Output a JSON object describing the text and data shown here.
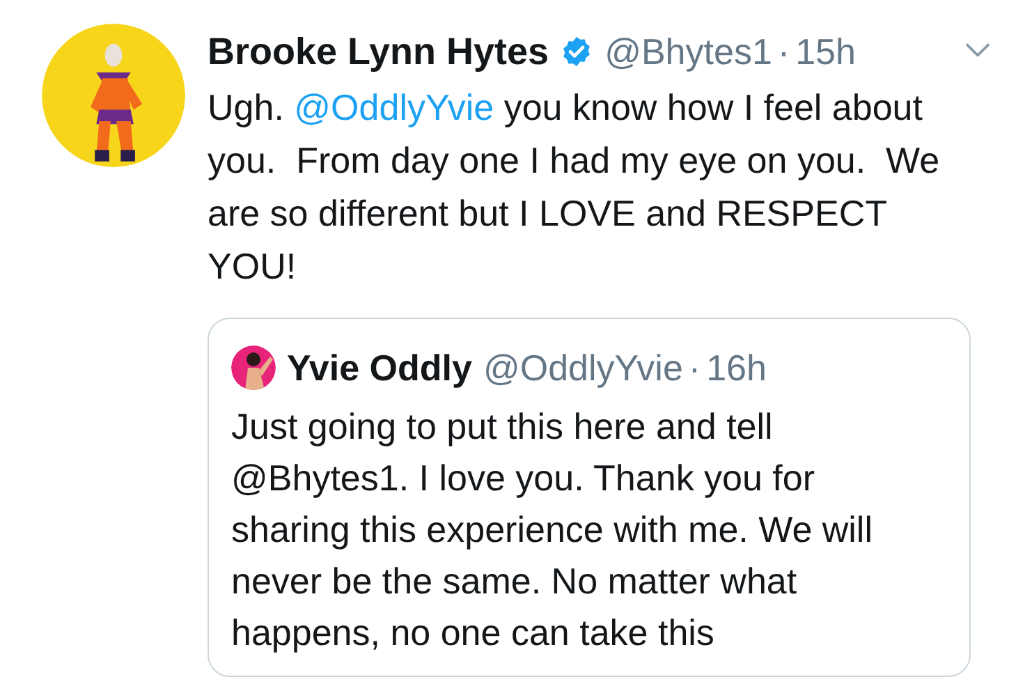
{
  "tweet": {
    "name": "Brooke Lynn Hytes",
    "verified": true,
    "handle": "@Bhytes1",
    "separator": "·",
    "time": "15h",
    "text": [
      {
        "kind": "plain",
        "text": "Ugh. "
      },
      {
        "kind": "mention",
        "text": "@OddlyYvie"
      },
      {
        "kind": "plain",
        "text": " you know how I feel about you.  From day one I had my eye on you.  We are so different but I LOVE and RESPECT YOU!"
      }
    ],
    "quoted": {
      "name": "Yvie Oddly",
      "handle": "@OddlyYvie",
      "separator": "·",
      "time": "16h",
      "text": "Just going to put this here and tell @Bhytes1. I love you. Thank you for sharing this experience with me. We will never be the same. No matter what happens, no one can take this"
    }
  }
}
